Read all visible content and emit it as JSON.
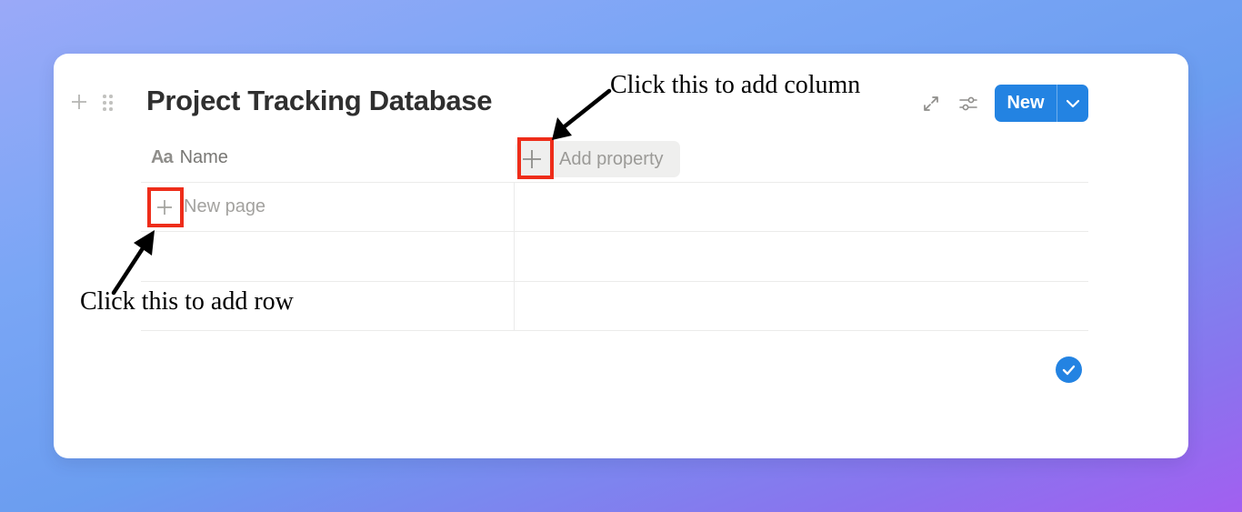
{
  "database": {
    "title": "Project Tracking Database",
    "new_button_label": "New"
  },
  "table": {
    "columns": [
      {
        "icon": "text-property-icon",
        "icon_text": "Aa",
        "label": "Name"
      }
    ],
    "add_property_label": "Add property",
    "new_row_label": "New page",
    "row_count": 3
  },
  "annotations": {
    "add_column": "Click this to add column",
    "add_row": "Click this to add row"
  },
  "colors": {
    "accent": "#2383e2",
    "highlight": "#ee2d1a"
  }
}
